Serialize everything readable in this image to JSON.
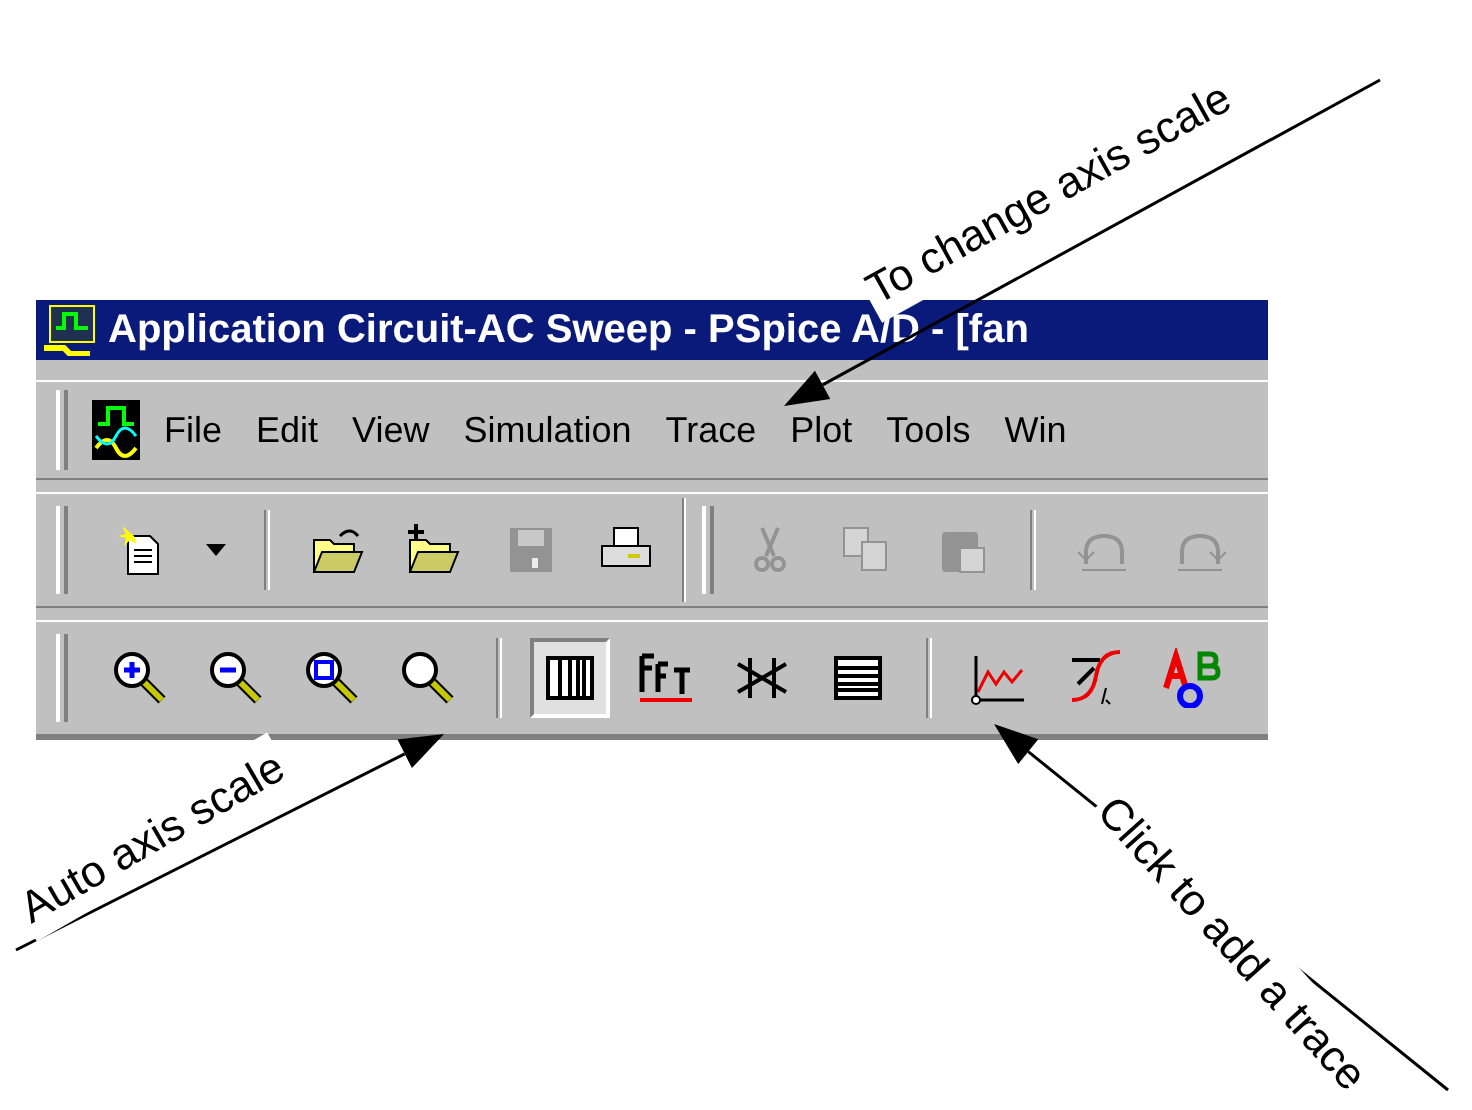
{
  "window": {
    "title": "Application Circuit-AC Sweep - PSpice A/D  - [fan"
  },
  "menu": [
    {
      "label": "File"
    },
    {
      "label": "Edit"
    },
    {
      "label": "View"
    },
    {
      "label": "Simulation"
    },
    {
      "label": "Trace"
    },
    {
      "label": "Plot"
    },
    {
      "label": "Tools"
    },
    {
      "label": "Win"
    }
  ],
  "toolbars": [
    {
      "items": [
        {
          "kind": "new",
          "disabled": false
        },
        {
          "kind": "caret",
          "disabled": false
        },
        {
          "kind": "separator"
        },
        {
          "kind": "open",
          "disabled": false
        },
        {
          "kind": "open-add",
          "disabled": false
        },
        {
          "kind": "save",
          "disabled": true
        },
        {
          "kind": "print",
          "disabled": false
        },
        {
          "kind": "grip"
        },
        {
          "kind": "cut",
          "disabled": true
        },
        {
          "kind": "copy",
          "disabled": true
        },
        {
          "kind": "paste",
          "disabled": true
        },
        {
          "kind": "separator"
        },
        {
          "kind": "undo",
          "disabled": true
        },
        {
          "kind": "redo",
          "disabled": true
        }
      ]
    },
    {
      "items": [
        {
          "kind": "zoom-in",
          "selected": false
        },
        {
          "kind": "zoom-out",
          "selected": false
        },
        {
          "kind": "zoom-area",
          "selected": false
        },
        {
          "kind": "zoom-fit",
          "selected": false
        },
        {
          "kind": "separator"
        },
        {
          "kind": "columns",
          "selected": true
        },
        {
          "kind": "fft",
          "selected": false
        },
        {
          "kind": "cross",
          "selected": false
        },
        {
          "kind": "rows",
          "selected": false
        },
        {
          "kind": "separator"
        },
        {
          "kind": "add-trace",
          "selected": false
        },
        {
          "kind": "trace-function",
          "selected": false
        },
        {
          "kind": "labels",
          "selected": false
        }
      ]
    }
  ],
  "annotations": [
    {
      "text": "To change axis scale"
    },
    {
      "text": "Auto axis scale"
    },
    {
      "text": "Click to add a trace"
    }
  ]
}
